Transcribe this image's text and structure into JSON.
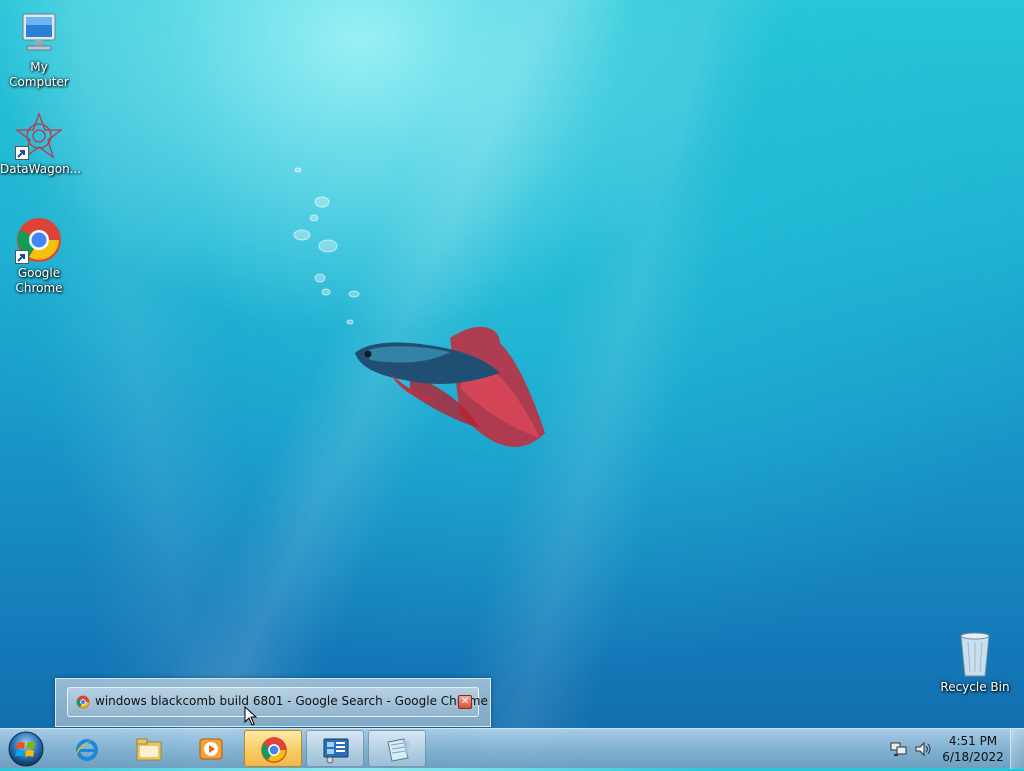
{
  "desktop": {
    "icons": [
      {
        "label": "My Computer",
        "icon": "computer-icon"
      },
      {
        "label": "DataWagon...",
        "icon": "datawagon-icon"
      },
      {
        "label": "Google Chrome",
        "icon": "chrome-icon"
      },
      {
        "label": "Recycle Bin",
        "icon": "recycle-bin-icon"
      }
    ]
  },
  "preview": {
    "title": "windows blackcomb build 6801 - Google Search - Google Chrome",
    "close_glyph": "✕",
    "icon": "chrome-icon"
  },
  "taskbar": {
    "start": {
      "icon": "windows-start-icon"
    },
    "buttons": [
      {
        "icon": "internet-explorer-icon",
        "state": "pinned"
      },
      {
        "icon": "file-explorer-icon",
        "state": "pinned"
      },
      {
        "icon": "media-player-icon",
        "state": "pinned"
      },
      {
        "icon": "chrome-icon",
        "state": "active"
      },
      {
        "icon": "control-panel-icon",
        "state": "open"
      },
      {
        "icon": "notepad-icon",
        "state": "open"
      }
    ],
    "tray": {
      "icons": [
        "network-icon",
        "volume-icon"
      ],
      "time": "4:51 PM",
      "date": "6/18/2022"
    }
  },
  "colors": {
    "active_task": "#f7d06a",
    "desktop_top": "#28c6d8",
    "desktop_bottom": "#116aa9"
  }
}
